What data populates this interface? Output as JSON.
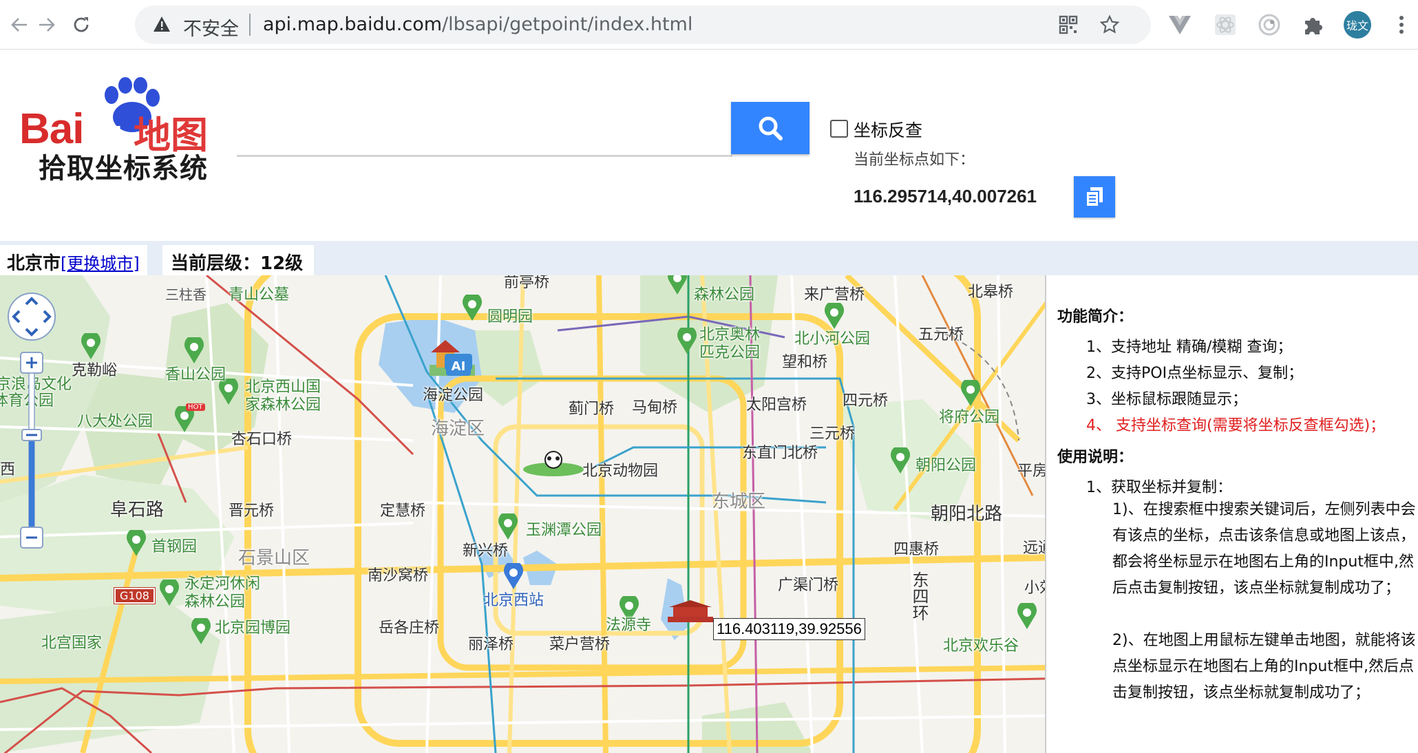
{
  "browser": {
    "insecure_label": "不安全",
    "url_host": "api.map.baidu.com",
    "url_path": "/lbsapi/getpoint/index.html",
    "profile_label": "珑文"
  },
  "header": {
    "logo_brand_bai": "Bai",
    "logo_brand_du": "du",
    "logo_brand_cn": "地图",
    "logo_subtitle": "拾取坐标系统",
    "search_placeholder": "",
    "reverse_label": "坐标反查",
    "coord_label": "当前坐标点如下：",
    "coord_value": "116.295714,40.007261"
  },
  "infobar": {
    "city": "北京市",
    "change_city": "更换城市",
    "level_label": "当前层级：12级"
  },
  "map": {
    "tooltip": "116.403119,39.92556",
    "labels": {
      "sanzhuxiang": "三柱香",
      "qingshanmu": "青山公墓",
      "qianting": "前亭桥",
      "yuanmingyuan": "圆明园",
      "laiguangying": "来广营桥",
      "beigao": "北皋桥",
      "senlin": "森林公园",
      "aolinpike": "北京奥林\n匹克公园",
      "beixiaohe": "北小河公园",
      "wuyuan": "五元桥",
      "wanghe": "望和桥",
      "kelezhu": "克勒峪",
      "xiangshan": "香山公园",
      "xishan": "北京西山国\n家森林公园",
      "haidiangongyuan": "海淀公园",
      "jimen": "蓟门桥",
      "madian": "马甸桥",
      "taiyanggong": "太阳宫桥",
      "siyuan": "四元桥",
      "jiangfu": "将府公园",
      "badachu": "八大处公园",
      "xingshikou": "杏石口桥",
      "haidianqu": "海淀区",
      "sanyuan": "三元桥",
      "dongzhimen": "东直门北桥",
      "dongwuyuan": "北京动物园",
      "chaoyanggongyuan": "朝阳公园",
      "pingfang": "平房",
      "fushilu": "阜石路",
      "jinyuan": "晋元桥",
      "dinghui": "定慧桥",
      "dongchengqu": "东城区",
      "chaoyangbeilu": "朝阳北路",
      "yuyuantan": "玉渊潭公园",
      "shougang": "首钢园",
      "xinxing": "新兴桥",
      "shijingshan": "石景山区",
      "sihui": "四惠桥",
      "yuanjiang": "远通",
      "nanshawo": "南沙窝桥",
      "guangqumen": "广渠门桥",
      "yongding": "永定河休闲\n森林公园",
      "beijingxizhan": "北京西站",
      "fayuansi": "法源寺",
      "dongsihuan": "东四环",
      "g108": "G108",
      "yuanbo": "北京园博园",
      "yuegezhuang": "岳各庄桥",
      "beigongguojia": "北宫国家",
      "lizeqiao": "丽泽桥",
      "caihu": "菜户营桥",
      "huanle": "北京欢乐谷",
      "xiaoxiao": "小郊",
      "lanlang": "京浪岛文化",
      "tiyu": "体育公园",
      "ai": "AI",
      "hot": "HOT",
      "ailabel_xi": "西",
      "left_edge_x": "西"
    }
  },
  "panel": {
    "intro_title": "功能简介：",
    "intro_items": [
      "1、支持地址 精确/模糊 查询；",
      "2、支持POI点坐标显示、复制；",
      "3、坐标鼠标跟随显示；",
      "4、 支持坐标查询(需要将坐标反查框勾选)；"
    ],
    "usage_title": "使用说明：",
    "usage_item1": "1、获取坐标并复制：",
    "usage_para1": "1)、在搜索框中搜索关键词后，左侧列表中会有该点的坐标，点击该条信息或地图上该点，都会将坐标显示在地图右上角的Input框中,然后点击复制按钮，该点坐标就复制成功了；",
    "usage_para2": "2)、在地图上用鼠标左键单击地图，就能将该点坐标显示在地图右上角的Input框中,然后点击复制按钮，该点坐标就复制成功了；"
  },
  "colors": {
    "accent_blue": "#3385ff",
    "logo_red": "#d82c2c",
    "logo_blue": "#2f4fd8",
    "highlight_red": "#e02020",
    "infobar_bg": "#e6edf7"
  }
}
